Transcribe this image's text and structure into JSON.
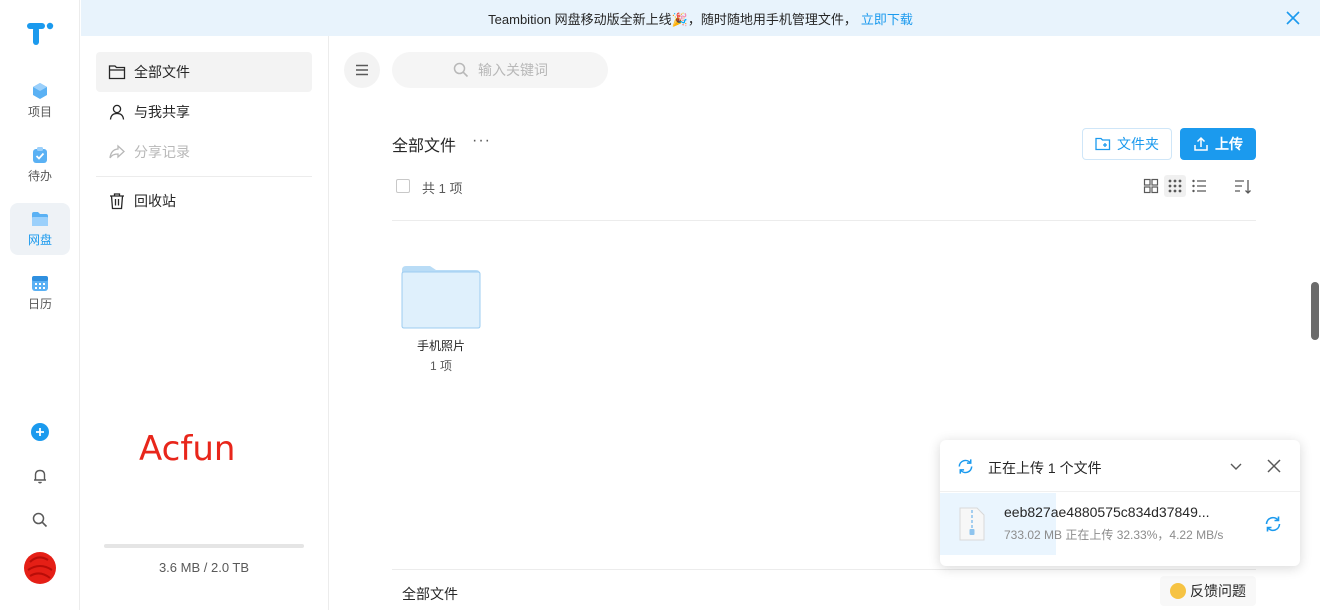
{
  "banner": {
    "text": "Teambition 网盘移动版全新上线🎉，随时随地用手机管理文件，",
    "link": "立即下载"
  },
  "rail": {
    "items": [
      {
        "label": "项目",
        "icon": "project-icon"
      },
      {
        "label": "待办",
        "icon": "todo-icon"
      },
      {
        "label": "网盘",
        "icon": "drive-icon",
        "active": true
      },
      {
        "label": "日历",
        "icon": "calendar-icon"
      }
    ],
    "add_icon": "plus-circle-icon",
    "bell_icon": "bell-icon",
    "search_icon": "search-icon",
    "avatar": "avatar"
  },
  "subnav": {
    "items": [
      {
        "label": "全部文件",
        "icon": "folder-open-icon",
        "active": true
      },
      {
        "label": "与我共享",
        "icon": "user-icon"
      },
      {
        "label": "分享记录",
        "icon": "share-icon",
        "disabled": true
      },
      {
        "label": "回收站",
        "icon": "trash-icon"
      }
    ],
    "storage": "3.6 MB / 2.0 TB",
    "storage_fraction": 2e-06,
    "watermark": "Acfun"
  },
  "main": {
    "search_placeholder": "输入关键词",
    "title": "全部文件",
    "more": "···",
    "new_folder": "文件夹",
    "upload": "上传",
    "count": "共 1 项",
    "folders": [
      {
        "name": "手机照片",
        "count": "1 项"
      }
    ],
    "breadcrumb": "全部文件",
    "feedback": "反馈问题"
  },
  "upload_panel": {
    "title": "正在上传 1 个文件",
    "file_name": "eeb827ae4880575c834d37849...",
    "file_meta": "733.02 MB 正在上传 32.33%，4.22 MB/s",
    "progress": 0.3233
  },
  "colors": {
    "accent": "#1b9aee",
    "banner_bg": "#e8f3fc",
    "watermark": "#e8261b"
  }
}
